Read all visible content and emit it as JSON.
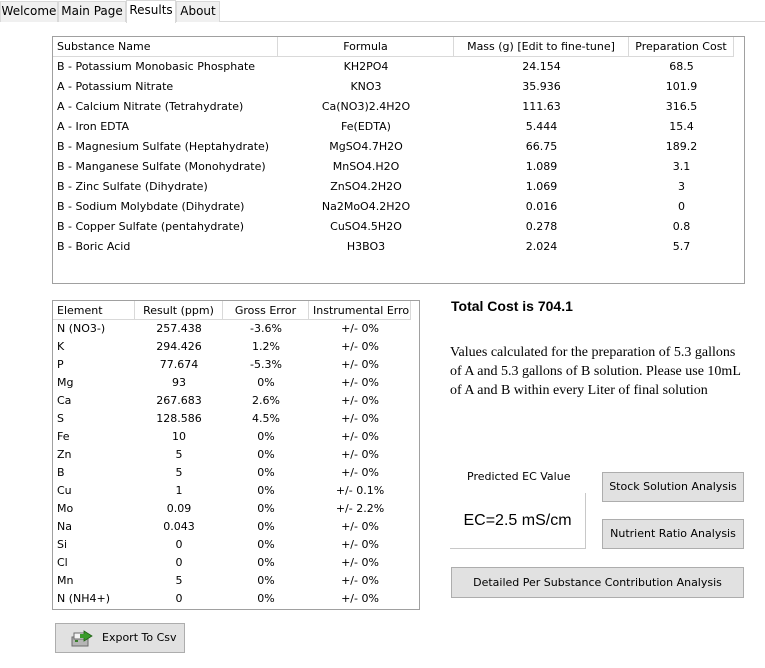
{
  "tabs": [
    {
      "label": "Welcome"
    },
    {
      "label": "Main Page"
    },
    {
      "label": "Results"
    },
    {
      "label": "About"
    }
  ],
  "substances": {
    "columns": [
      "Substance Name",
      "Formula",
      "Mass (g) [Edit to fine-tune]",
      "Preparation Cost"
    ],
    "rows": [
      [
        "B - Potassium Monobasic Phosphate",
        "KH2PO4",
        "24.154",
        "68.5"
      ],
      [
        "A - Potassium Nitrate",
        "KNO3",
        "35.936",
        "101.9"
      ],
      [
        "A - Calcium Nitrate (Tetrahydrate)",
        "Ca(NO3)2.4H2O",
        "111.63",
        "316.5"
      ],
      [
        "A - Iron EDTA",
        "Fe(EDTA)",
        "5.444",
        "15.4"
      ],
      [
        "B - Magnesium Sulfate (Heptahydrate)",
        "MgSO4.7H2O",
        "66.75",
        "189.2"
      ],
      [
        "B - Manganese Sulfate (Monohydrate)",
        "MnSO4.H2O",
        "1.089",
        "3.1"
      ],
      [
        "B - Zinc Sulfate (Dihydrate)",
        "ZnSO4.2H2O",
        "1.069",
        "3"
      ],
      [
        "B - Sodium Molybdate (Dihydrate)",
        "Na2MoO4.2H2O",
        "0.016",
        "0"
      ],
      [
        "B - Copper Sulfate (pentahydrate)",
        "CuSO4.5H2O",
        "0.278",
        "0.8"
      ],
      [
        "B - Boric Acid",
        "H3BO3",
        "2.024",
        "5.7"
      ]
    ]
  },
  "elements": {
    "columns": [
      "Element",
      "Result (ppm)",
      "Gross Error",
      "Instrumental Error"
    ],
    "rows": [
      [
        "N (NO3-)",
        "257.438",
        "-3.6%",
        "+/- 0%"
      ],
      [
        "K",
        "294.426",
        "1.2%",
        "+/- 0%"
      ],
      [
        "P",
        "77.674",
        "-5.3%",
        "+/- 0%"
      ],
      [
        "Mg",
        "93",
        "0%",
        "+/- 0%"
      ],
      [
        "Ca",
        "267.683",
        "2.6%",
        "+/- 0%"
      ],
      [
        "S",
        "128.586",
        "4.5%",
        "+/- 0%"
      ],
      [
        "Fe",
        "10",
        "0%",
        "+/- 0%"
      ],
      [
        "Zn",
        "5",
        "0%",
        "+/- 0%"
      ],
      [
        "B",
        "5",
        "0%",
        "+/- 0%"
      ],
      [
        "Cu",
        "1",
        "0%",
        "+/- 0.1%"
      ],
      [
        "Mo",
        "0.09",
        "0%",
        "+/- 2.2%"
      ],
      [
        "Na",
        "0.043",
        "0%",
        "+/- 0%"
      ],
      [
        "Si",
        "0",
        "0%",
        "+/- 0%"
      ],
      [
        "Cl",
        "0",
        "0%",
        "+/- 0%"
      ],
      [
        "Mn",
        "5",
        "0%",
        "+/- 0%"
      ],
      [
        "N (NH4+)",
        "0",
        "0%",
        "+/- 0%"
      ]
    ]
  },
  "summary": {
    "total_cost": "Total Cost is 704.1",
    "description": "Values calculated for the preparation of 5.3 gallons of A and 5.3 gallons of B solution. Please use 10mL of A and B within every Liter of final solution",
    "ec_label": "Predicted EC Value",
    "ec_value": "EC=2.5 mS/cm"
  },
  "buttons": {
    "stock_solution": "Stock Solution Analysis",
    "nutrient_ratio": "Nutrient Ratio Analysis",
    "detailed": "Detailed Per Substance Contribution Analysis",
    "export_csv": "Export To Csv"
  },
  "icons": {
    "export": "csv-export-icon"
  },
  "colors": {
    "button_bg": "#e1e1e1",
    "grid_border": "#a0a0a0",
    "tab_inactive_bg": "#f0f0f0"
  }
}
